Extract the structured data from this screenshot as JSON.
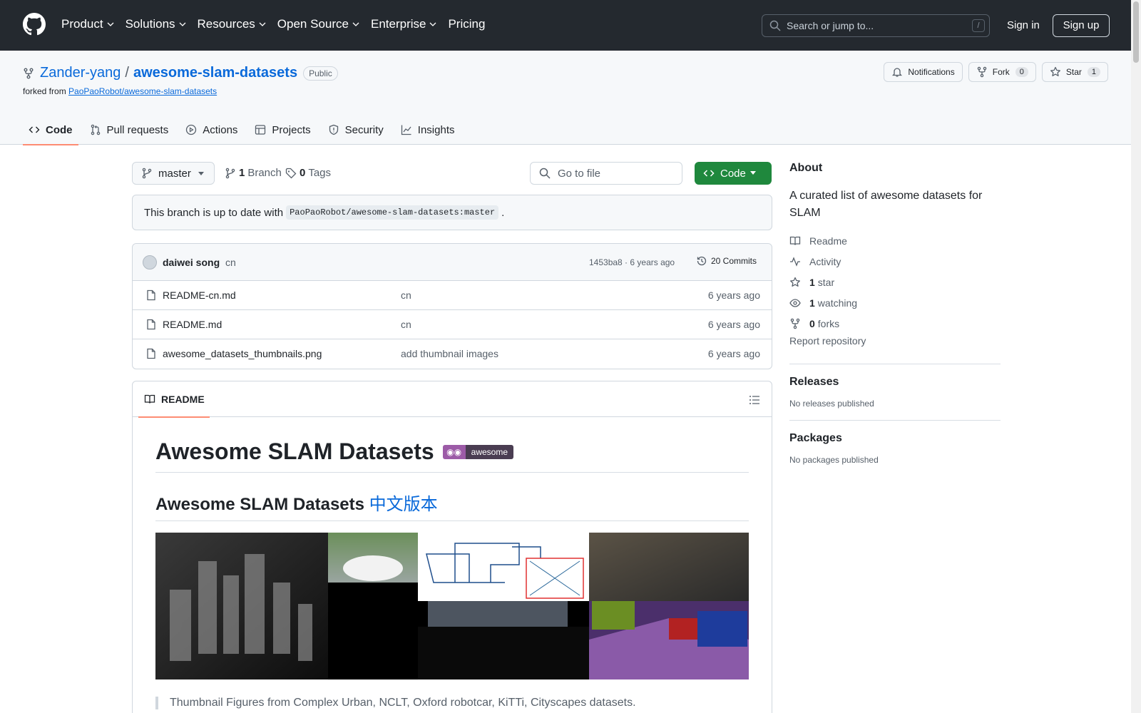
{
  "header": {
    "nav": [
      "Product",
      "Solutions",
      "Resources",
      "Open Source",
      "Enterprise",
      "Pricing"
    ],
    "search_placeholder": "Search or jump to...",
    "search_shortcut": "/",
    "signin": "Sign in",
    "signup": "Sign up"
  },
  "repo": {
    "owner": "Zander-yang",
    "separator": "/",
    "name": "awesome-slam-datasets",
    "visibility": "Public",
    "forked_prefix": "forked from",
    "forked_from": "PaoPaoRobot/awesome-slam-datasets",
    "notifications_label": "Notifications",
    "fork_label": "Fork",
    "fork_count": "0",
    "star_label": "Star",
    "star_count": "1",
    "tabs": [
      "Code",
      "Pull requests",
      "Actions",
      "Projects",
      "Security",
      "Insights"
    ]
  },
  "toolbar": {
    "branch": "master",
    "branch_count": "1",
    "branch_label": "Branch",
    "tag_count": "0",
    "tag_label": "Tags",
    "goto_placeholder": "Go to file",
    "code_label": "Code"
  },
  "status": {
    "prefix": "This branch is up to date with",
    "ref": "PaoPaoRobot/awesome-slam-datasets:master",
    "suffix": "."
  },
  "commit": {
    "author": "daiwei song",
    "message": "cn",
    "meta": "1453ba8 · 6 years ago",
    "commits_label": "20 Commits"
  },
  "files": [
    {
      "name": "README-cn.md",
      "message": "cn",
      "age": "6 years ago"
    },
    {
      "name": "README.md",
      "message": "cn",
      "age": "6 years ago"
    },
    {
      "name": "awesome_datasets_thumbnails.png",
      "message": "add thumbnail images",
      "age": "6 years ago"
    }
  ],
  "readme": {
    "tab": "README",
    "h1": "Awesome SLAM Datasets",
    "badge_right": "awesome",
    "h2_text": "Awesome SLAM Datasets",
    "h2_link": "中文版本",
    "quote": "Thumbnail Figures from Complex Urban, NCLT, Oxford robotcar, KiTTi, Cityscapes datasets."
  },
  "sidebar": {
    "about_title": "About",
    "description": "A curated list of awesome datasets for SLAM",
    "readme": "Readme",
    "activity": "Activity",
    "stars_count": "1",
    "stars_label": "star",
    "watching_count": "1",
    "watching_label": "watching",
    "forks_count": "0",
    "forks_label": "forks",
    "report": "Report repository",
    "releases_title": "Releases",
    "releases_empty": "No releases published",
    "packages_title": "Packages",
    "packages_empty": "No packages published"
  },
  "colors": {
    "header_bg": "#24292f",
    "link": "#0969da",
    "code_button": "#1f883d",
    "tab_underline": "#fd8c73"
  }
}
